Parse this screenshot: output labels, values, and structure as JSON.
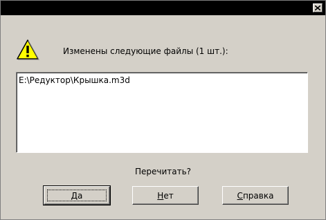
{
  "dialog": {
    "title": "",
    "message": "Изменены следующие файлы (1 шт.):",
    "files": [
      "E:\\Редуктор\\Крышка.m3d"
    ],
    "question": "Перечитать?"
  },
  "buttons": {
    "yes": {
      "label_first": "Д",
      "label_rest": "а"
    },
    "no": {
      "label_first": "Н",
      "label_rest": "ет"
    },
    "help": {
      "label_first": "С",
      "label_rest": "правка"
    }
  },
  "icons": {
    "close": "close-icon",
    "warning": "warning-icon"
  },
  "colors": {
    "face": "#d4d0c8",
    "titlebar": "#000000",
    "list_bg": "#ffffff",
    "warning_fill": "#ffff00"
  }
}
